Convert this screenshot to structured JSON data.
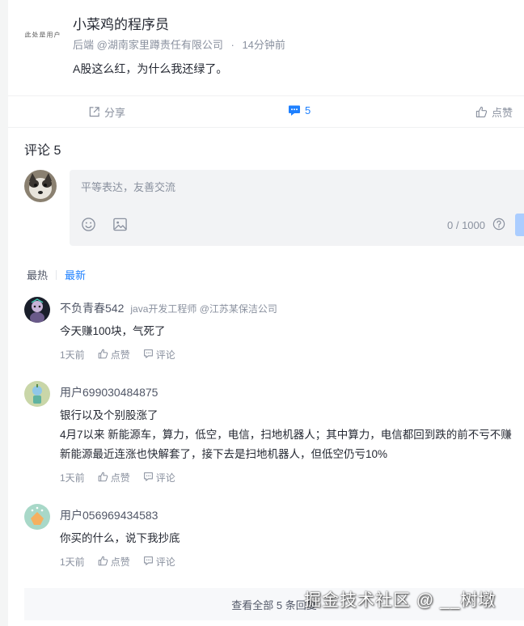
{
  "post": {
    "avatar_logo_text": "此处是用户",
    "author": "小菜鸡的程序员",
    "meta_role": "后端",
    "meta_company": "@湖南家里蹲责任有限公司",
    "meta_sep": "·",
    "meta_time": "14分钟前",
    "text": "A股这么红，为什么我还绿了。",
    "actions": {
      "share_label": "分享",
      "comment_count": "5",
      "like_label": "点赞"
    }
  },
  "comments": {
    "title": "评论 5",
    "editor": {
      "placeholder": "平等表达，友善交流",
      "count": "0 / 1000"
    },
    "sort": {
      "hot": "最热",
      "new": "最新"
    },
    "items": [
      {
        "name": "不负青春542",
        "job": "java开发工程师 @江苏某保洁公司",
        "lines": [
          "今天赚100块，气死了"
        ],
        "time": "1天前",
        "like": "点赞",
        "reply": "评论"
      },
      {
        "name": "用户699030484875",
        "job": "",
        "lines": [
          "银行以及个别股涨了",
          "4月7以来 新能源车，算力，低空，电信，扫地机器人；其中算力，电信都回到跌的前不亏不赚",
          "新能源最近连涨也快解套了，接下去是扫地机器人，但低空仍亏10%"
        ],
        "time": "1天前",
        "like": "点赞",
        "reply": "评论"
      },
      {
        "name": "用户056969434583",
        "job": "",
        "lines": [
          "你买的什么，说下我抄底"
        ],
        "time": "1天前",
        "like": "点赞",
        "reply": "评论"
      }
    ],
    "view_all": "查看全部 5 条回复"
  },
  "watermark": "掘金技术社区 @ __树墩",
  "colors": {
    "accent": "#1e80ff",
    "text": "#252933",
    "muted": "#8a919f",
    "editor_bg": "#f2f3f5"
  }
}
